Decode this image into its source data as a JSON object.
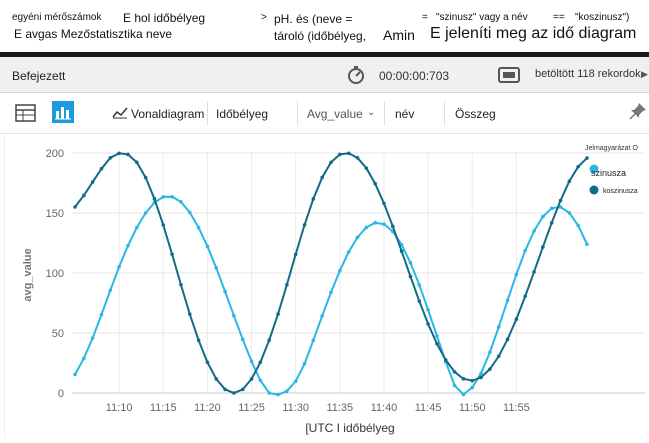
{
  "query": {
    "line1": [
      "egyéni mérőszámok",
      "E hol időbélyeg",
      ">",
      "pH. és (neve =",
      "=",
      "\"szinusz\" vagy a név",
      "==",
      "\"koszinusz\")"
    ],
    "line2": [
      "E avgas Mezőstatisztika neve",
      "tároló (időbélyeg,",
      "Amin",
      "E jeleníti meg az idő diagram"
    ]
  },
  "status": {
    "state": "Befejezett",
    "elapsed": "00:00:00:703",
    "records": "betöltött 118 rekordok"
  },
  "toolbar": {
    "chart_type": "Vonaldiagram",
    "x_column": "Időbélyeg",
    "y_column": "Avg_value",
    "split_column": "név",
    "aggregation": "Összeg"
  },
  "colors": {
    "szinusza": "#2bb7e6",
    "koszinusza": "#146a85",
    "accent": "#1b9be0"
  },
  "icons": [
    "table-icon",
    "column-chart-icon",
    "line-chart-icon",
    "chevron-down-icon",
    "stopwatch-icon",
    "records-icon",
    "pin-icon"
  ],
  "chart_data": {
    "type": "line",
    "xlabel": "[UTC I időbélyeg",
    "ylabel": "avg_value",
    "ylim": [
      0,
      200
    ],
    "y_ticks": [
      0,
      50,
      100,
      150,
      200
    ],
    "x_ticks": [
      "11:10",
      "11:15",
      "11:20",
      "11:25",
      "11:30",
      "11:35",
      "11:40",
      "11:45",
      "11:50",
      "11:55"
    ],
    "legend_title": "Jelmagyarázat O",
    "legend_position": "top-right",
    "grid": true,
    "x_minutes": [
      0,
      1,
      2,
      3,
      4,
      5,
      6,
      7,
      8,
      9,
      10,
      11,
      12,
      13,
      14,
      15,
      16,
      17,
      18,
      19,
      20,
      21,
      22,
      23,
      24,
      25,
      26,
      27,
      28,
      29,
      30,
      31,
      32,
      33,
      34,
      35,
      36,
      37,
      38,
      39,
      40,
      41,
      42,
      43,
      44,
      45,
      46,
      47,
      48,
      49,
      50,
      51,
      52,
      53,
      54,
      55,
      56,
      57,
      58
    ],
    "x_start": "11:05",
    "series": [
      {
        "name": "szinusza",
        "values": [
          15.4,
          28.8,
          45.8,
          65.3,
          85.6,
          105.2,
          122.8,
          137.9,
          150.0,
          158.7,
          163.4,
          163.5,
          159.3,
          150.5,
          137.9,
          122.2,
          104.2,
          84.6,
          64.4,
          44.7,
          26.4,
          10.5,
          0.0,
          -1.4,
          1.5,
          9.8,
          24.3,
          44.0,
          64.2,
          83.9,
          102.0,
          117.5,
          129.7,
          138.0,
          141.8,
          140.7,
          134.6,
          123.6,
          108.5,
          90.1,
          69.3,
          47.6,
          26.0,
          6.3,
          -1.2,
          4.6,
          16.4,
          34.0,
          55.0,
          77.2,
          98.9,
          118.6,
          135.0,
          147.0,
          153.9,
          155.0,
          150.1,
          139.6,
          124.0
        ]
      },
      {
        "name": "koszinusza",
        "values": [
          155.0,
          164.6,
          175.8,
          186.9,
          196.0,
          199.8,
          198.8,
          192.3,
          179.6,
          161.8,
          140.0,
          115.6,
          90.2,
          65.8,
          44.0,
          25.6,
          11.7,
          3.0,
          0.0,
          3.0,
          11.7,
          25.6,
          44.0,
          65.8,
          90.2,
          115.6,
          140.0,
          161.8,
          179.6,
          192.3,
          198.8,
          199.8,
          196.0,
          187.4,
          174.5,
          158.0,
          138.9,
          118.2,
          97.1,
          76.6,
          57.6,
          41.0,
          27.5,
          17.6,
          11.8,
          10.3,
          13.0,
          19.9,
          30.6,
          44.7,
          61.6,
          80.6,
          100.9,
          121.6,
          141.8,
          160.4,
          176.5,
          188.6,
          195.8
        ]
      }
    ]
  }
}
